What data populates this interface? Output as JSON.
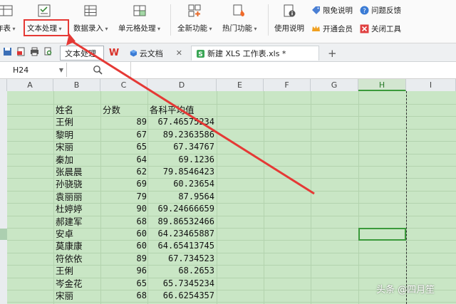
{
  "ribbon": {
    "partial_table": "作表",
    "text_processing": "文本处理",
    "data_entry": "数据录入",
    "cell_processing": "单元格处理",
    "all_functions": "全新功能",
    "hot_functions": "热门功能",
    "usage_guide": "使用说明",
    "free_limit": "限免说明",
    "feedback": "问题反馈",
    "membership": "开通会员",
    "close_tools": "关闭工具"
  },
  "tabs": {
    "text_processing_tab": "文本处理",
    "cloud_docs": "云文档",
    "doc_title": "新建 XLS 工作表.xls *",
    "add": "+"
  },
  "formula_bar": {
    "name_box": "H24"
  },
  "columns": [
    "A",
    "B",
    "C",
    "D",
    "E",
    "F",
    "G",
    "H",
    "I"
  ],
  "table": {
    "headers": [
      "姓名",
      "分数",
      "各科平均值"
    ],
    "rows": [
      [
        "王俐",
        "89",
        "67.46575234"
      ],
      [
        "黎明",
        "67",
        "89.2363586"
      ],
      [
        "宋丽",
        "65",
        "67.34767"
      ],
      [
        "秦加",
        "64",
        "69.1236"
      ],
      [
        "张晨晨",
        "62",
        "79.8546423"
      ],
      [
        "孙骁骁",
        "69",
        "60.23654"
      ],
      [
        "袁丽丽",
        "79",
        "87.9564"
      ],
      [
        "杜婷婷",
        "90",
        "69.24666659"
      ],
      [
        "郝建军",
        "68",
        "89.86532466"
      ],
      [
        "安卓",
        "60",
        "64.23465887"
      ],
      [
        "莫康康",
        "60",
        "64.65413745"
      ],
      [
        "符依依",
        "89",
        "67.734523"
      ],
      [
        "王俐",
        "96",
        "68.2653"
      ],
      [
        "岑金花",
        "65",
        "65.7345234"
      ],
      [
        "宋丽",
        "68",
        "66.6254357"
      ]
    ]
  },
  "watermark": "头条 @四月笙",
  "colors": {
    "sheet_bg": "#c9e6c5",
    "highlight": "#e53935",
    "active": "#3b9a3b"
  }
}
